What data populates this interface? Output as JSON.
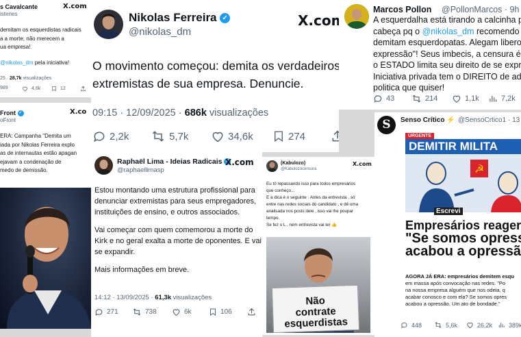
{
  "tw1": {
    "name": "s Cavalcante",
    "handle": "istenes",
    "x_logo": "X.com",
    "body_lines": [
      "demitam os esquerdistas radicais",
      "a a morte; não merecem a",
      "ua empresa!"
    ],
    "mention": "@nikolas_dm",
    "mention_suffix": " pela iniciativa!",
    "meta_time": "25 · ",
    "meta_views": "28,7k",
    "meta_views_label": " visualizações",
    "stats": {
      "retweets": "989",
      "likes": "4,6k",
      "bookmarks": "12"
    }
  },
  "tw2": {
    "name": "Nikolas Ferreira",
    "handle": "@nikolas_dm",
    "x_logo": "X.com",
    "body_lines": [
      "O movimento começou: demita os verdadeiros",
      "extremistas de sua empresa. Denuncie."
    ],
    "meta_time": "09:15 · 12/09/2025 · ",
    "meta_views": "686k",
    "meta_views_label": " visualizações",
    "stats": {
      "replies": "2,2k",
      "retweets": "5,7k",
      "likes": "34,6k",
      "bookmarks": "274"
    }
  },
  "tw3": {
    "name": "Marcos Pollon",
    "handle": "@PollonMarcos · 9h",
    "body_lines": [
      "A esquerdalha está tirando a calcinha p",
      "cabeça pq o ",
      "demitam esquerdopatas. Alegam libero",
      "expressão\"! Seus imbecis, a censura é",
      "o ESTADO limita seu direito de se expr",
      "Iniciativa privada tem o DIREITO de ado",
      "politica que quiser!"
    ],
    "mention": "@nikolas_dm",
    "mention_suffix": " recomendo",
    "stats": {
      "replies": "43",
      "retweets": "214",
      "likes": "1,1k",
      "views": "7,2k"
    }
  },
  "tw4": {
    "name": "Front",
    "handle": "oFront",
    "x_logo": "X.co",
    "body_lines": [
      "ERA: Campanha \"Demita um",
      "iada por Nikolas Ferreira explo",
      "as de internautas estão apagan",
      "ejavam a condenação de",
      "medo de demissão."
    ]
  },
  "tw5": {
    "name": "Raphaël Lima - Ideias Radicais",
    "handle": "@raphaellimasp",
    "x_logo": "X.com",
    "body_lines": [
      "Estou montando uma estrutura profissional para",
      "denunciar extremistas para seus empregadores,",
      "instituições de ensino, e outros associados.",
      "",
      "Vai começar com quem comemorou a morte do",
      "Kirk e no geral exalta a morte de oponentes. E vai",
      "se expandir.",
      "",
      "Mais informações em breve."
    ],
    "meta_time": "14:12 · 13/09/2025 · ",
    "meta_views": "61,3k",
    "meta_views_label": " visualizações",
    "stats": {
      "replies": "271",
      "retweets": "738",
      "likes": "6k",
      "bookmarks": "106"
    }
  },
  "tw6": {
    "name": "(Kabulozo)",
    "handle": "@Kabulozocensura",
    "x_logo": "X.com",
    "body_lines": [
      "Eu tô repassando isso para todos empresários",
      "que conheço...",
      "E a dica é o seguinte : Antes da entrevista , só",
      "entre nas redes sociais do candidato , e dê uma",
      "analisada nos posts dele , isso vai lhe poupar",
      "tempo.",
      "Se fez o L , nem entrevista vai ter 👍"
    ],
    "sign_lines": [
      "Não",
      "contrate",
      "esquerdistas"
    ]
  },
  "tw7": {
    "name": "Senso Crítico ⚡",
    "handle": "@SensoCrtico1 · 13",
    "avatar_letter": "S",
    "urgent": "URGENTE",
    "banner": "DEMITIR MILITA",
    "brand": "Escrevi",
    "headline_lines": [
      "Empresários reager",
      "\"Se somos opresso",
      "acabou a opressão\""
    ],
    "body_lines": [
      "AGORA JÁ ERA: empresários demitem esqu",
      "em massa após convocação nas redes. \"Po",
      "na nossa empresa alguém que nos odeia, q",
      "acabar conosco e com ela? Se somos opres",
      "acabou a opressão. Um ato de bondade.\""
    ],
    "stats": {
      "replies": "448",
      "retweets": "5,6k",
      "likes": "26,2k",
      "views": "389k"
    }
  },
  "colors": {
    "accent": "#1d9bf0",
    "text": "#0f1419",
    "muted": "#536471",
    "urgent": "#d9232d",
    "banner": "#1d5fb3"
  }
}
